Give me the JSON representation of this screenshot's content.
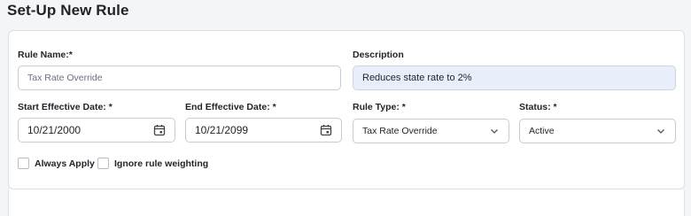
{
  "page": {
    "title": "Set-Up New Rule"
  },
  "form": {
    "rule_name": {
      "label": "Rule Name:*",
      "placeholder": "Tax Rate Override",
      "value": ""
    },
    "description": {
      "label": "Description",
      "value": "Reduces state rate to 2%"
    },
    "start_date": {
      "label": "Start Effective Date: *",
      "value": "10/21/2000"
    },
    "end_date": {
      "label": "End Effective Date: *",
      "value": "10/21/2099"
    },
    "rule_type": {
      "label": "Rule Type: *",
      "selected": "Tax Rate Override"
    },
    "status": {
      "label": "Status: *",
      "selected": "Active"
    },
    "always_apply": {
      "label": "Always Apply",
      "checked": false
    },
    "ignore_weighting": {
      "label": "Ignore rule weighting",
      "checked": false
    }
  },
  "icons": {
    "date_picker": "calendar-icon",
    "dropdown": "chevron-down-icon"
  },
  "colors": {
    "description_bg": "#e8effb",
    "border": "#c8ccd2",
    "page_bg": "#f4f5f7"
  }
}
